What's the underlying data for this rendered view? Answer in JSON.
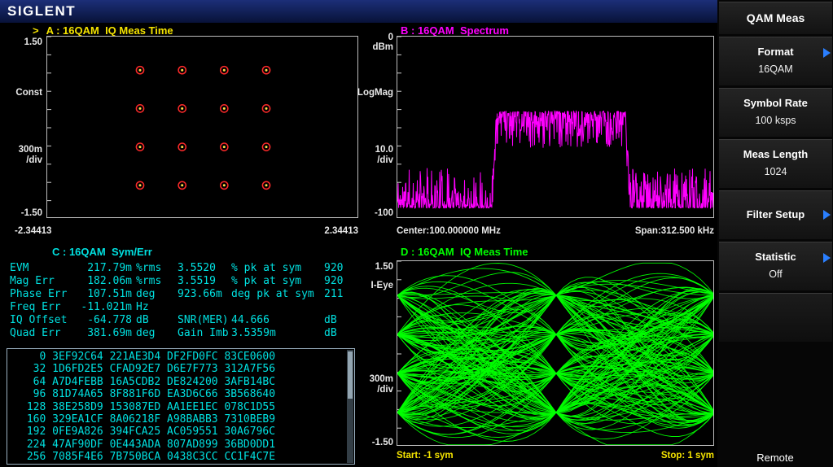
{
  "brand": "SIGLENT",
  "colors": {
    "yellow": "#f5e400",
    "magenta": "#ff00ff",
    "cyan": "#00e0e0",
    "green": "#00ff00",
    "blue": "#2a7fff",
    "topbar1": "#1c2f78",
    "topbar2": "#081238",
    "ring": "#ff2a2a",
    "dot": "#ffe14a"
  },
  "panels": {
    "a": {
      "marker": ">",
      "title": "A : 16QAM  IQ Meas Time",
      "y_top": "1.50",
      "y_name": "Const",
      "y_div": "300m",
      "y_div_unit": "/div",
      "y_bottom": "-1.50",
      "x_left": "-2.34413",
      "x_right": "2.34413"
    },
    "b": {
      "title": "B : 16QAM  Spectrum",
      "y_top": "0",
      "y_top_unit": "dBm",
      "y_name": "LogMag",
      "y_div": "10.0",
      "y_div_unit": "/div",
      "y_bottom": "-100",
      "x_left": "Center:100.000000 MHz",
      "x_right": "Span:312.500 kHz"
    },
    "c": {
      "title": "C : 16QAM  Sym/Err",
      "stats": [
        [
          "EVM",
          "217.79m",
          "%rms",
          "3.5520",
          "% pk at sym",
          "920"
        ],
        [
          "Mag Err",
          "182.06m",
          "%rms",
          "3.5519",
          "% pk at sym",
          "920"
        ],
        [
          "Phase Err",
          "107.51m",
          "deg",
          "923.66m",
          "deg pk at sym",
          "211"
        ],
        [
          "Freq Err",
          "-11.021m",
          "Hz",
          "",
          "",
          ""
        ],
        [
          "IQ Offset",
          "-64.778",
          "dB",
          "SNR(MER)",
          "44.666",
          "dB"
        ],
        [
          "Quad Err",
          "381.69m",
          "deg",
          "Gain Imb",
          "3.5359m",
          "dB"
        ]
      ],
      "hex_rows": [
        {
          "offset": "0",
          "words": [
            "3EF92C64",
            "221AE3D4",
            "DF2FD0FC",
            "83CE0600"
          ]
        },
        {
          "offset": "32",
          "words": [
            "1D6FD2E5",
            "CFAD92E7",
            "D6E7F773",
            "312A7F56"
          ]
        },
        {
          "offset": "64",
          "words": [
            "A7D4FEBB",
            "16A5CDB2",
            "DE824200",
            "3AFB14BC"
          ]
        },
        {
          "offset": "96",
          "words": [
            "81D74A65",
            "8F881F6D",
            "EA3D6C66",
            "3B568640"
          ]
        },
        {
          "offset": "128",
          "words": [
            "38E258D9",
            "153087ED",
            "AA1EE1EC",
            "078C1D55"
          ]
        },
        {
          "offset": "160",
          "words": [
            "329EA1CF",
            "8A06218F",
            "A98BABB3",
            "7310BEB9"
          ]
        },
        {
          "offset": "192",
          "words": [
            "0FE9A826",
            "394FCA25",
            "AC059551",
            "30A6796C"
          ]
        },
        {
          "offset": "224",
          "words": [
            "47AF90DF",
            "0E443ADA",
            "807AD899",
            "36BD0DD1"
          ]
        },
        {
          "offset": "256",
          "words": [
            "7085F4E6",
            "7B750BCA",
            "0438C3CC",
            "CC1F4C7E"
          ]
        }
      ]
    },
    "d": {
      "title": "D : 16QAM  IQ Meas Time",
      "y_top": "1.50",
      "y_name": "I-Eye",
      "y_div": "300m",
      "y_div_unit": "/div",
      "y_bottom": "-1.50",
      "x_left": "Start: -1 sym",
      "x_right": "Stop: 1 sym"
    }
  },
  "sidebar": {
    "header": "QAM Meas",
    "items": [
      {
        "label": "Format",
        "value": "16QAM",
        "arrow": true
      },
      {
        "label": "Symbol Rate",
        "value": "100 ksps",
        "arrow": false
      },
      {
        "label": "Meas Length",
        "value": "1024",
        "arrow": false
      },
      {
        "label": "Filter Setup",
        "value": "",
        "arrow": true
      },
      {
        "label": "Statistic",
        "value": "Off",
        "arrow": true
      },
      {
        "label": "",
        "value": "",
        "arrow": false
      }
    ],
    "status": "Remote"
  },
  "chart_data": [
    {
      "id": "constellation",
      "type": "scatter",
      "panel": "A",
      "title": "16QAM IQ Meas Time constellation",
      "xlim": [
        -2.34413,
        2.34413
      ],
      "ylim": [
        -1.5,
        1.5
      ],
      "y_per_div": 0.3,
      "points": [
        [
          -0.9487,
          -0.9487
        ],
        [
          -0.9487,
          -0.3162
        ],
        [
          -0.9487,
          0.3162
        ],
        [
          -0.9487,
          0.9487
        ],
        [
          -0.3162,
          -0.9487
        ],
        [
          -0.3162,
          -0.3162
        ],
        [
          -0.3162,
          0.3162
        ],
        [
          -0.3162,
          0.9487
        ],
        [
          0.3162,
          -0.9487
        ],
        [
          0.3162,
          -0.3162
        ],
        [
          0.3162,
          0.3162
        ],
        [
          0.3162,
          0.9487
        ],
        [
          0.9487,
          -0.9487
        ],
        [
          0.9487,
          -0.3162
        ],
        [
          0.9487,
          0.3162
        ],
        [
          0.9487,
          0.9487
        ]
      ]
    },
    {
      "id": "spectrum",
      "type": "line",
      "panel": "B",
      "title": "16QAM Spectrum",
      "center": "100.000000 MHz",
      "span": "312.500 kHz",
      "ylim_db": [
        -100,
        0
      ],
      "db_per_div": 10,
      "band_left_frac": 0.305,
      "band_right_frac": 0.725,
      "band_top_db": -41,
      "band_depth_db": 20,
      "noise_floor_db": -94,
      "noise_spike_db": 22,
      "seed": 11
    },
    {
      "id": "eye",
      "type": "line",
      "panel": "D",
      "title": "16QAM I-Eye diagram",
      "x_sym": [
        -1,
        1
      ],
      "ylim": [
        -1.5,
        1.5
      ],
      "levels": [
        -0.9487,
        -0.3162,
        0.3162,
        0.9487
      ],
      "traces": 150,
      "spread": 1.15,
      "seed": 5
    }
  ]
}
